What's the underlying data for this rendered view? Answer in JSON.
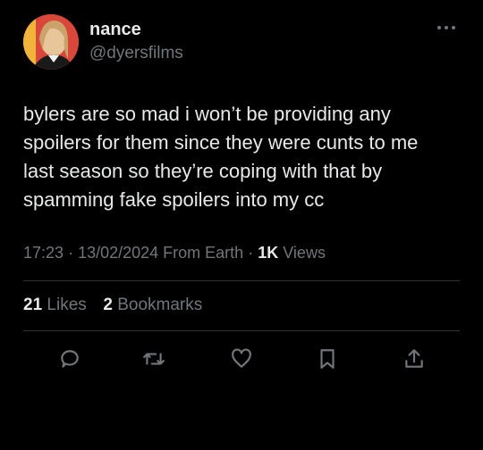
{
  "user": {
    "display_name": "nance",
    "handle": "@dyersfilms",
    "avatar_icon": "profile-photo"
  },
  "tweet": {
    "lines": [
      "bylers are so mad i won’t be providing any",
      "spoilers for them since they were cunts to me",
      "last season so they’re coping with that by",
      "spamming fake spoilers into my cc"
    ]
  },
  "meta": {
    "time": "17:23",
    "date": "13/02/2024",
    "source": "From Earth",
    "views_count": "1K",
    "views_label": "Views"
  },
  "stats": {
    "likes_count": "21",
    "likes_label": "Likes",
    "bookmarks_count": "2",
    "bookmarks_label": "Bookmarks"
  },
  "actions": {
    "icons": [
      "reply-icon",
      "retweet-icon",
      "like-icon",
      "bookmark-icon",
      "share-icon"
    ]
  },
  "colors": {
    "background": "#000000",
    "text": "#e7e9ea",
    "secondary": "#71767b",
    "divider": "#2f3336"
  }
}
